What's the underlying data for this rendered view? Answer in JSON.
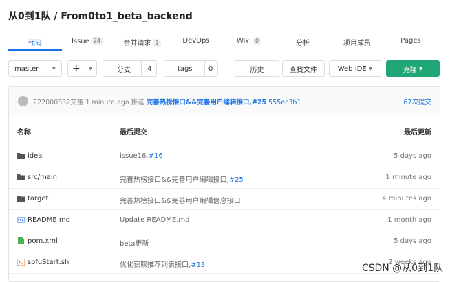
{
  "header": {
    "title": "从0到1队 / From0to1_beta_backend"
  },
  "tabs": [
    {
      "label": "代码",
      "badge": ""
    },
    {
      "label": "Issue",
      "badge": "24"
    },
    {
      "label": "合并请求",
      "badge": "1"
    },
    {
      "label": "DevOps",
      "badge": ""
    },
    {
      "label": "Wiki",
      "badge": "0"
    },
    {
      "label": "分析",
      "badge": ""
    },
    {
      "label": "项目成员",
      "badge": ""
    },
    {
      "label": "Pages",
      "badge": ""
    }
  ],
  "toolbar": {
    "branch": "master",
    "add": "+",
    "branches_label": "分支",
    "branches_count": "4",
    "tags_label": "tags",
    "tags_count": "0",
    "history": "历史",
    "find_file": "查找文件",
    "web_ide": "Web IDE",
    "clone": "克隆"
  },
  "commit": {
    "author": "222000332艾笛",
    "time": "1 minute ago",
    "action": "推送",
    "message": "完善热榜接口&&完善用户编辑接口,#25",
    "hash": "555ec3b1",
    "count": "67次提交"
  },
  "table": {
    "headers": [
      "名称",
      "最后提交",
      "最后更新"
    ],
    "rows": [
      {
        "name": "idea",
        "type": "folder",
        "msg": "issue16,",
        "link": "#16",
        "time": "5 days ago"
      },
      {
        "name": "src/main",
        "type": "folder",
        "msg": "完善热榜接口&&完善用户编辑接口,",
        "link": "#25",
        "time": "1 minute ago"
      },
      {
        "name": "target",
        "type": "folder",
        "msg": "完善热榜接口&&完善用户编辑信息接口",
        "link": "",
        "time": "4 minutes ago"
      },
      {
        "name": "README.md",
        "type": "markdown",
        "msg": "Update README.md",
        "link": "",
        "time": "1 month ago"
      },
      {
        "name": "pom.xml",
        "type": "xml",
        "msg": "beta更新",
        "link": "",
        "time": "5 days ago"
      },
      {
        "name": "sofuStart.sh",
        "type": "shell",
        "msg": "优化获取推荐列表接口,",
        "link": "#13",
        "time": "2 weeks ago"
      }
    ]
  },
  "watermark": "CSDN @从0到1队",
  "colors": {
    "accent": "#1a73e8",
    "clone": "#21a675"
  }
}
